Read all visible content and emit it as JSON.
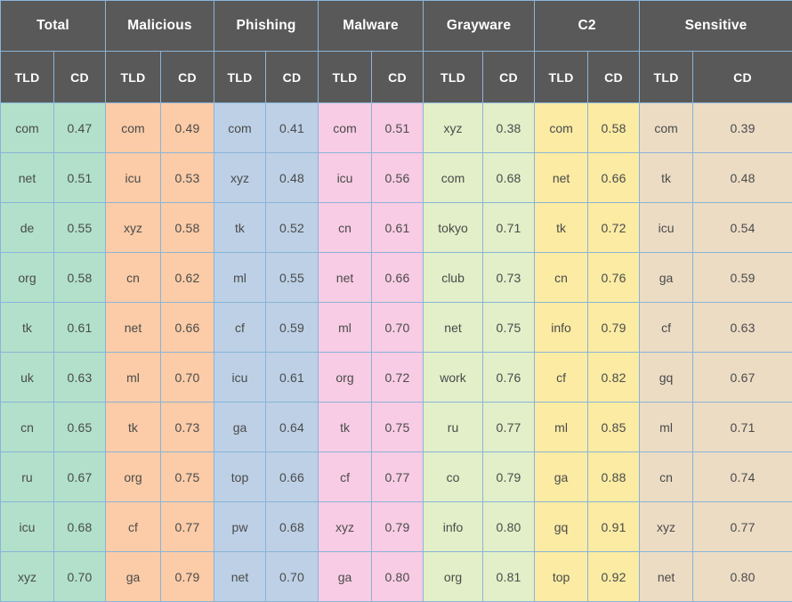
{
  "table": {
    "column_groups": [
      {
        "label": "Total",
        "key": "total",
        "color": "#b2e0cb",
        "class": "g-total"
      },
      {
        "label": "Malicious",
        "key": "malicious",
        "color": "#fbcca7",
        "class": "g-malicious"
      },
      {
        "label": "Phishing",
        "key": "phishing",
        "color": "#bdd0e6",
        "class": "g-phishing"
      },
      {
        "label": "Malware",
        "key": "malware",
        "color": "#f8cce4",
        "class": "g-malware"
      },
      {
        "label": "Grayware",
        "key": "grayware",
        "color": "#e2efc8",
        "class": "g-grayware"
      },
      {
        "label": "C2",
        "key": "c2",
        "color": "#fbeba3",
        "class": "g-c2"
      },
      {
        "label": "Sensitive",
        "key": "sensitive",
        "color": "#ecdcc4",
        "class": "g-sensitive"
      }
    ],
    "sub_headers": {
      "tld": "TLD",
      "cd": "CD"
    },
    "header_bg": "#595959",
    "header_text_color": "#ffffff",
    "gridline_color": "#8ab4d8",
    "rows": [
      {
        "total": {
          "tld": "com",
          "cd": "0.47"
        },
        "malicious": {
          "tld": "com",
          "cd": "0.49"
        },
        "phishing": {
          "tld": "com",
          "cd": "0.41"
        },
        "malware": {
          "tld": "com",
          "cd": "0.51"
        },
        "grayware": {
          "tld": "xyz",
          "cd": "0.38"
        },
        "c2": {
          "tld": "com",
          "cd": "0.58"
        },
        "sensitive": {
          "tld": "com",
          "cd": "0.39"
        }
      },
      {
        "total": {
          "tld": "net",
          "cd": "0.51"
        },
        "malicious": {
          "tld": "icu",
          "cd": "0.53"
        },
        "phishing": {
          "tld": "xyz",
          "cd": "0.48"
        },
        "malware": {
          "tld": "icu",
          "cd": "0.56"
        },
        "grayware": {
          "tld": "com",
          "cd": "0.68"
        },
        "c2": {
          "tld": "net",
          "cd": "0.66"
        },
        "sensitive": {
          "tld": "tk",
          "cd": "0.48"
        }
      },
      {
        "total": {
          "tld": "de",
          "cd": "0.55"
        },
        "malicious": {
          "tld": "xyz",
          "cd": "0.58"
        },
        "phishing": {
          "tld": "tk",
          "cd": "0.52"
        },
        "malware": {
          "tld": "cn",
          "cd": "0.61"
        },
        "grayware": {
          "tld": "tokyo",
          "cd": "0.71"
        },
        "c2": {
          "tld": "tk",
          "cd": "0.72"
        },
        "sensitive": {
          "tld": "icu",
          "cd": "0.54"
        }
      },
      {
        "total": {
          "tld": "org",
          "cd": "0.58"
        },
        "malicious": {
          "tld": "cn",
          "cd": "0.62"
        },
        "phishing": {
          "tld": "ml",
          "cd": "0.55"
        },
        "malware": {
          "tld": "net",
          "cd": "0.66"
        },
        "grayware": {
          "tld": "club",
          "cd": "0.73"
        },
        "c2": {
          "tld": "cn",
          "cd": "0.76"
        },
        "sensitive": {
          "tld": "ga",
          "cd": "0.59"
        }
      },
      {
        "total": {
          "tld": "tk",
          "cd": "0.61"
        },
        "malicious": {
          "tld": "net",
          "cd": "0.66"
        },
        "phishing": {
          "tld": "cf",
          "cd": "0.59"
        },
        "malware": {
          "tld": "ml",
          "cd": "0.70"
        },
        "grayware": {
          "tld": "net",
          "cd": "0.75"
        },
        "c2": {
          "tld": "info",
          "cd": "0.79"
        },
        "sensitive": {
          "tld": "cf",
          "cd": "0.63"
        }
      },
      {
        "total": {
          "tld": "uk",
          "cd": "0.63"
        },
        "malicious": {
          "tld": "ml",
          "cd": "0.70"
        },
        "phishing": {
          "tld": "icu",
          "cd": "0.61"
        },
        "malware": {
          "tld": "org",
          "cd": "0.72"
        },
        "grayware": {
          "tld": "work",
          "cd": "0.76"
        },
        "c2": {
          "tld": "cf",
          "cd": "0.82"
        },
        "sensitive": {
          "tld": "gq",
          "cd": "0.67"
        }
      },
      {
        "total": {
          "tld": "cn",
          "cd": "0.65"
        },
        "malicious": {
          "tld": "tk",
          "cd": "0.73"
        },
        "phishing": {
          "tld": "ga",
          "cd": "0.64"
        },
        "malware": {
          "tld": "tk",
          "cd": "0.75"
        },
        "grayware": {
          "tld": "ru",
          "cd": "0.77"
        },
        "c2": {
          "tld": "ml",
          "cd": "0.85"
        },
        "sensitive": {
          "tld": "ml",
          "cd": "0.71"
        }
      },
      {
        "total": {
          "tld": "ru",
          "cd": "0.67"
        },
        "malicious": {
          "tld": "org",
          "cd": "0.75"
        },
        "phishing": {
          "tld": "top",
          "cd": "0.66"
        },
        "malware": {
          "tld": "cf",
          "cd": "0.77"
        },
        "grayware": {
          "tld": "co",
          "cd": "0.79"
        },
        "c2": {
          "tld": "ga",
          "cd": "0.88"
        },
        "sensitive": {
          "tld": "cn",
          "cd": "0.74"
        }
      },
      {
        "total": {
          "tld": "icu",
          "cd": "0.68"
        },
        "malicious": {
          "tld": "cf",
          "cd": "0.77"
        },
        "phishing": {
          "tld": "pw",
          "cd": "0.68"
        },
        "malware": {
          "tld": "xyz",
          "cd": "0.79"
        },
        "grayware": {
          "tld": "info",
          "cd": "0.80"
        },
        "c2": {
          "tld": "gq",
          "cd": "0.91"
        },
        "sensitive": {
          "tld": "xyz",
          "cd": "0.77"
        }
      },
      {
        "total": {
          "tld": "xyz",
          "cd": "0.70"
        },
        "malicious": {
          "tld": "ga",
          "cd": "0.79"
        },
        "phishing": {
          "tld": "net",
          "cd": "0.70"
        },
        "malware": {
          "tld": "ga",
          "cd": "0.80"
        },
        "grayware": {
          "tld": "org",
          "cd": "0.81"
        },
        "c2": {
          "tld": "top",
          "cd": "0.92"
        },
        "sensitive": {
          "tld": "net",
          "cd": "0.80"
        }
      }
    ]
  }
}
